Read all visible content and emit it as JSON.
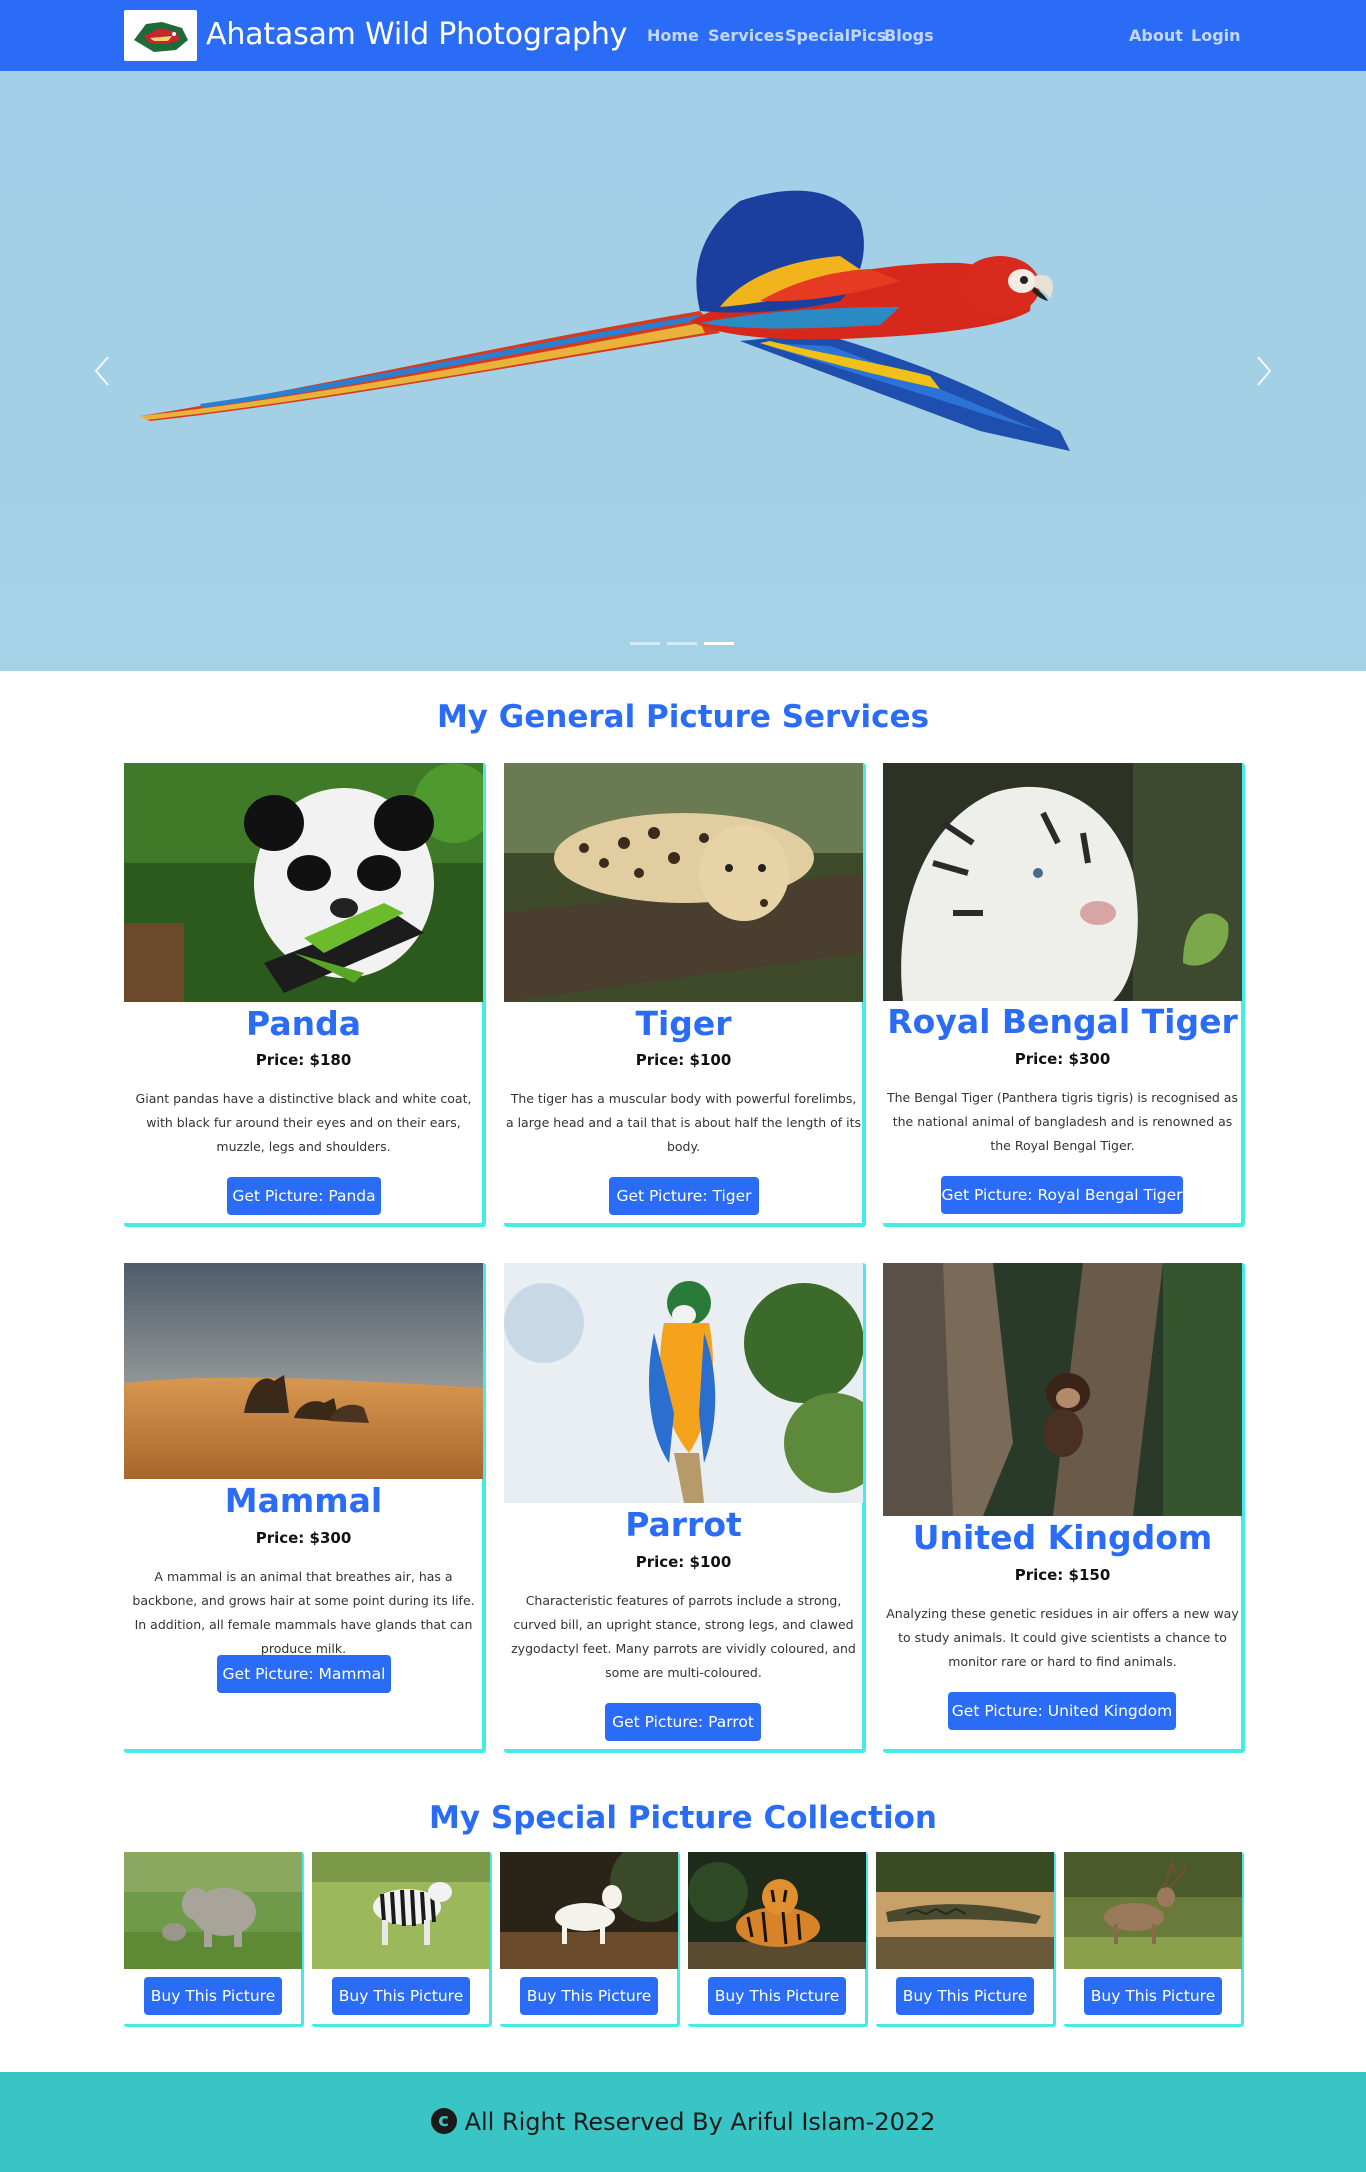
{
  "navbar": {
    "brand": "Ahatasam Wild Photography",
    "links": [
      "Home",
      "Services",
      "SpecialPics",
      "Blogs"
    ],
    "right_links": [
      "About",
      "Login"
    ],
    "accent": "#2a6cf5"
  },
  "hero": {
    "image": "scarlet-macaw-flying",
    "indicator_count": 3,
    "active_indicator": 3
  },
  "services": {
    "title": "My General Picture Services",
    "cards": [
      {
        "title": "Panda",
        "price": "Price: $180",
        "description": "Giant pandas have a distinctive black and white coat, with black fur around their eyes and on their ears, muzzle, legs and shoulders.",
        "button": "Get Picture: Panda",
        "image": "panda"
      },
      {
        "title": "Tiger",
        "price": "Price: $100",
        "description": "The tiger has a muscular body with powerful forelimbs, a large head and a tail that is about half the length of its body.",
        "button": "Get Picture: Tiger",
        "image": "leopard"
      },
      {
        "title": "Royal Bengal Tiger",
        "price": "Price: $300",
        "description": "The Bengal Tiger (Panthera tigris tigris) is recognised as the national animal of bangladesh and is renowned as the Royal Bengal Tiger.",
        "button": "Get Picture: Royal Bengal Tiger",
        "image": "white-tiger"
      },
      {
        "title": "Mammal",
        "price": "Price: $300",
        "description": "A mammal is an animal that breathes air, has a backbone, and grows hair at some point during its life. In addition, all female mammals have glands that can produce milk.",
        "button": "Get Picture: Mammal",
        "image": "camels"
      },
      {
        "title": "Parrot",
        "price": "Price: $100",
        "description": "Characteristic features of parrots include a strong, curved bill, an upright stance, strong legs, and clawed zygodactyl feet. Many parrots are vividly coloured, and some are multi-coloured.",
        "button": "Get Picture: Parrot",
        "image": "macaw"
      },
      {
        "title": "United Kingdom",
        "price": "Price: $150",
        "description": "Analyzing these genetic residues in air offers a new way to study animals. It could give scientists a chance to monitor rare or hard to find animals.",
        "button": "Get Picture: United Kingdom",
        "image": "monkey"
      }
    ]
  },
  "special": {
    "title": "My Special Picture Collection",
    "items": [
      {
        "image": "elephants",
        "button": "Buy This Picture"
      },
      {
        "image": "zebra",
        "button": "Buy This Picture"
      },
      {
        "image": "white-horse",
        "button": "Buy This Picture"
      },
      {
        "image": "tiger",
        "button": "Buy This Picture"
      },
      {
        "image": "crocodile",
        "button": "Buy This Picture"
      },
      {
        "image": "deer",
        "button": "Buy This Picture"
      }
    ]
  },
  "footer": {
    "icon": "copyright-icon",
    "text": "All Right Reserved By Ariful Islam-2022",
    "background": "#39c5c5"
  }
}
